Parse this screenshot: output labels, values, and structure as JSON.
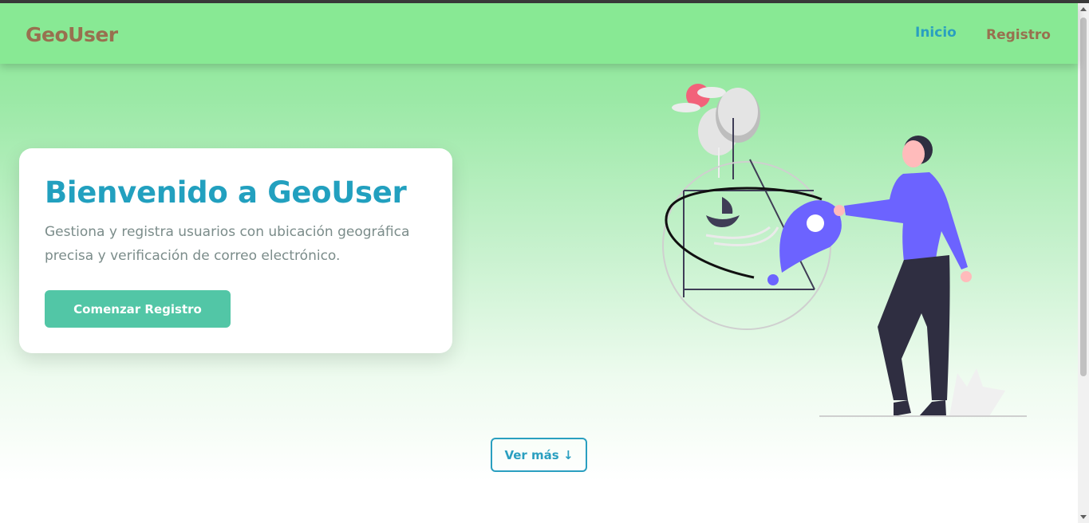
{
  "navbar": {
    "logo": "GeoUser",
    "links": [
      {
        "label": "Inicio",
        "active": true
      },
      {
        "label": "Registro",
        "active": false
      }
    ]
  },
  "hero": {
    "title": "Bienvenido a GeoUser",
    "subtitle": "Gestiona y registra usuarios con ubicación geográfica precisa y verificación de correo electrónico.",
    "cta_label": "Comenzar Registro"
  },
  "more_button": "Ver más ↓",
  "colors": {
    "navbar": "#88e994",
    "accent": "#22a0bf",
    "cta": "#52c6a6",
    "logo": "#98704f",
    "illustration_primary": "#6c63ff"
  }
}
